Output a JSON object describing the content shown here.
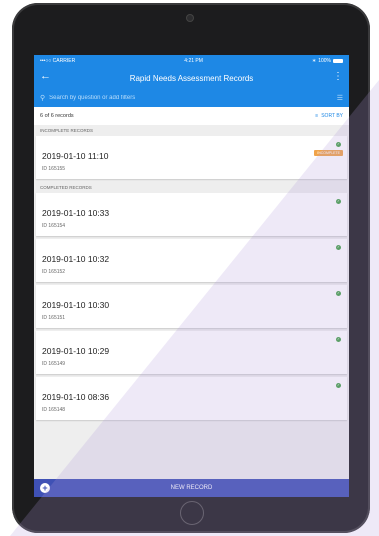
{
  "status_bar": {
    "carrier": "•••○○ CARRIER",
    "time": "4:21 PM",
    "battery": "100%"
  },
  "app_bar": {
    "title": "Rapid Needs Assessment Records"
  },
  "search": {
    "placeholder": "Search by question or add filters"
  },
  "count": {
    "label": "6 of 6 records",
    "sort_label": "SORT BY"
  },
  "sections": {
    "incomplete": "INCOMPLETE RECORDS",
    "completed": "COMPLETED RECORDS"
  },
  "incomplete_records": [
    {
      "date": "2019-01-10 11:10",
      "id": "ID 165155",
      "badge": "INCOMPLETE"
    }
  ],
  "completed_records": [
    {
      "date": "2019-01-10 10:33",
      "id": "ID 165154"
    },
    {
      "date": "2019-01-10 10:32",
      "id": "ID 165152"
    },
    {
      "date": "2019-01-10 10:30",
      "id": "ID 165151"
    },
    {
      "date": "2019-01-10 10:29",
      "id": "ID 165149"
    },
    {
      "date": "2019-01-10 08:36",
      "id": "ID 165148"
    }
  ],
  "bottom_bar": {
    "label": "NEW RECORD"
  },
  "colors": {
    "primary": "#1e88e5",
    "bottom": "#3f51b5",
    "success": "#43a047",
    "warning": "#f0a34a"
  }
}
